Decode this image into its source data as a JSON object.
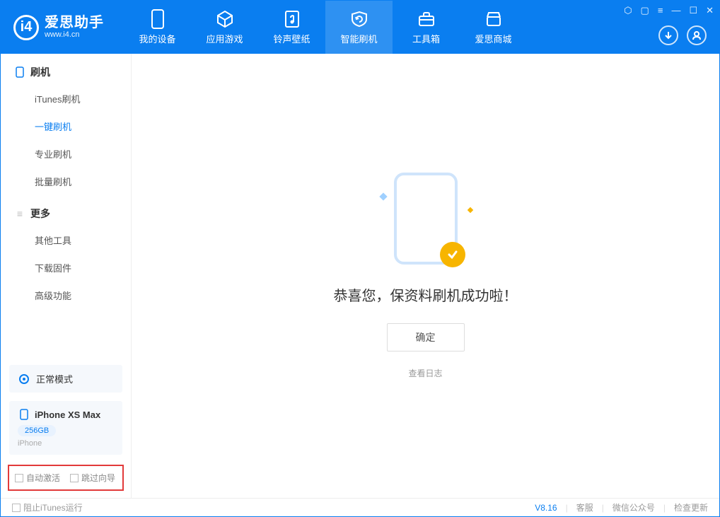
{
  "header": {
    "app_title": "爱思助手",
    "app_sub": "www.i4.cn",
    "nav": [
      {
        "label": "我的设备",
        "icon": "device-icon"
      },
      {
        "label": "应用游戏",
        "icon": "cube-icon"
      },
      {
        "label": "铃声壁纸",
        "icon": "music-icon"
      },
      {
        "label": "智能刷机",
        "icon": "refresh-icon",
        "active": true
      },
      {
        "label": "工具箱",
        "icon": "toolbox-icon"
      },
      {
        "label": "爱思商城",
        "icon": "store-icon"
      }
    ]
  },
  "sidebar": {
    "section1_title": "刷机",
    "items1": [
      {
        "label": "iTunes刷机"
      },
      {
        "label": "一键刷机",
        "active": true
      },
      {
        "label": "专业刷机"
      },
      {
        "label": "批量刷机"
      }
    ],
    "section2_title": "更多",
    "items2": [
      {
        "label": "其他工具"
      },
      {
        "label": "下载固件"
      },
      {
        "label": "高级功能"
      }
    ],
    "mode_card": {
      "label": "正常模式"
    },
    "device_card": {
      "name": "iPhone XS Max",
      "storage": "256GB",
      "type": "iPhone"
    },
    "checks": [
      {
        "label": "自动激活"
      },
      {
        "label": "跳过向导"
      }
    ]
  },
  "main": {
    "message": "恭喜您，保资料刷机成功啦！",
    "ok_label": "确定",
    "log_link": "查看日志"
  },
  "footer": {
    "block_itunes": "阻止iTunes运行",
    "version": "V8.16",
    "links": [
      "客服",
      "微信公众号",
      "检查更新"
    ]
  }
}
